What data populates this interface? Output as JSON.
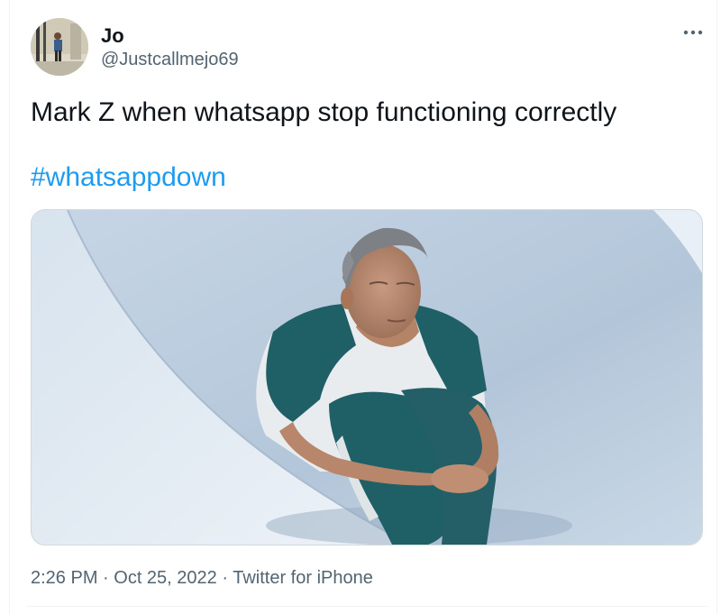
{
  "author": {
    "display_name": "Jo",
    "handle": "@Justcallmejo69"
  },
  "menu": {
    "icon": "more-horizontal-icon",
    "label": "···"
  },
  "tweet": {
    "text": "Mark Z when whatsapp stop functioning correctly",
    "hashtag": "#whatsappdown"
  },
  "media": {
    "type": "photo"
  },
  "footer": {
    "time": "2:26 PM",
    "separator": " · ",
    "date": "Oct 25, 2022",
    "source": "Twitter for iPhone"
  },
  "colors": {
    "link": "#1d9bf0",
    "secondary_text": "#536471",
    "primary_text": "#0f1419"
  }
}
